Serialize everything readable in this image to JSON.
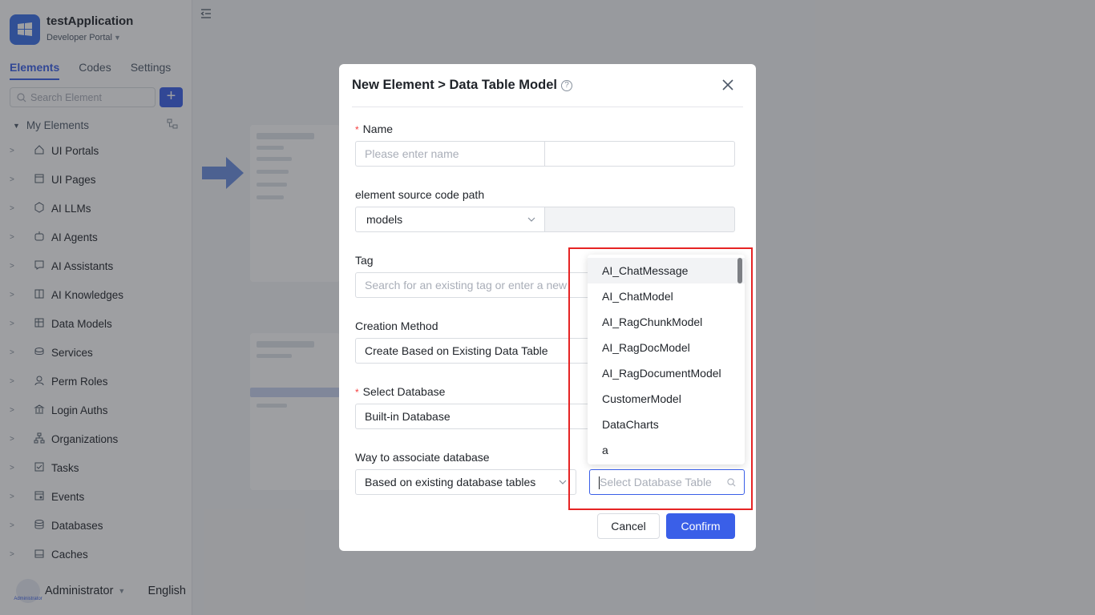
{
  "app": {
    "title": "testApplication",
    "subtitle": "Developer Portal",
    "logo_color": "#3a6fe8"
  },
  "sidebar": {
    "tabs": [
      {
        "label": "Elements",
        "active": true
      },
      {
        "label": "Codes",
        "active": false
      },
      {
        "label": "Settings",
        "active": false
      }
    ],
    "search_placeholder": "Search Element",
    "add_icon": "plus-icon",
    "group_label": "My Elements",
    "items": [
      {
        "label": "UI Portals",
        "icon": "home-icon"
      },
      {
        "label": "UI Pages",
        "icon": "pages-icon"
      },
      {
        "label": "AI LLMs",
        "icon": "llm-icon"
      },
      {
        "label": "AI Agents",
        "icon": "robot-icon"
      },
      {
        "label": "AI Assistants",
        "icon": "assistant-icon"
      },
      {
        "label": "AI Knowledges",
        "icon": "book-icon"
      },
      {
        "label": "Data Models",
        "icon": "table-icon"
      },
      {
        "label": "Services",
        "icon": "services-icon"
      },
      {
        "label": "Perm Roles",
        "icon": "role-icon"
      },
      {
        "label": "Login Auths",
        "icon": "bank-icon"
      },
      {
        "label": "Organizations",
        "icon": "org-icon"
      },
      {
        "label": "Tasks",
        "icon": "task-icon"
      },
      {
        "label": "Events",
        "icon": "event-icon"
      },
      {
        "label": "Databases",
        "icon": "database-icon"
      },
      {
        "label": "Caches",
        "icon": "cache-icon"
      }
    ],
    "user": {
      "name": "Administrator",
      "avatar_text": "Administrator"
    },
    "language": "English"
  },
  "modal": {
    "title": "New Element > Data Table Model",
    "name_label": "Name",
    "name_placeholder": "Please enter name",
    "path_label": "element source code path",
    "path_value": "models",
    "tag_label": "Tag",
    "tag_placeholder": "Search for an existing tag or enter a new",
    "method_label": "Creation Method",
    "method_value": "Create Based on Existing Data Table",
    "db_label": "Select Database",
    "db_value": "Built-in Database",
    "assoc_label": "Way to associate database",
    "assoc_value": "Based on existing database tables",
    "table_placeholder": "Select Database Table",
    "cancel_label": "Cancel",
    "confirm_label": "Confirm"
  },
  "dropdown": {
    "options": [
      "AI_ChatMessage",
      "AI_ChatModel",
      "AI_RagChunkModel",
      "AI_RagDocModel",
      "AI_RagDocumentModel",
      "CustomerModel",
      "DataCharts",
      "a"
    ]
  },
  "colors": {
    "accent": "#3a5fe8",
    "required": "#f53f3f",
    "highlight": "#e62424"
  }
}
